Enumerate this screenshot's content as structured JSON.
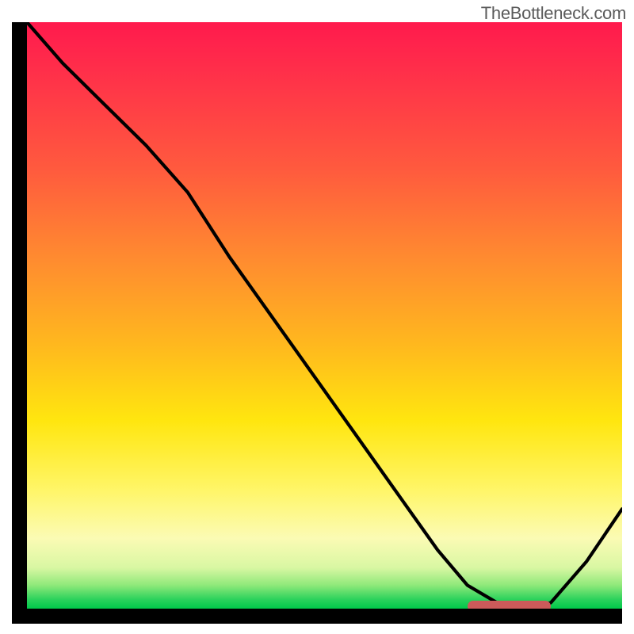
{
  "attribution": "TheBottleneck.com",
  "colors": {
    "gradient_top": "#ff1a4d",
    "gradient_mid": "#ffe60f",
    "gradient_bottom": "#00c84a",
    "curve": "#000000",
    "marker": "#cc5a5a",
    "border": "#000000"
  },
  "chart_data": {
    "type": "line",
    "title": "",
    "xlabel": "",
    "ylabel": "",
    "xlim": [
      0,
      100
    ],
    "ylim": [
      0,
      100
    ],
    "x": [
      0,
      6,
      13,
      20,
      27,
      34,
      41,
      48,
      55,
      62,
      69,
      74,
      79,
      84,
      88,
      94,
      100
    ],
    "values": [
      100,
      93,
      86,
      79,
      71,
      60,
      50,
      40,
      30,
      20,
      10,
      4,
      1,
      0,
      1,
      8,
      17
    ],
    "marker_range_x": [
      74,
      88
    ],
    "marker_y": 0.4,
    "notes": "Axes are unlabeled in source image; values are read proportionally to plot extents. Curve descends from top-left (red zone) through inflection near x≈27, reaches minimum near x≈84 at the green band, then rises toward bottom-right. Horizontal salmon marker bar sits at the curve minimum along the green band."
  }
}
